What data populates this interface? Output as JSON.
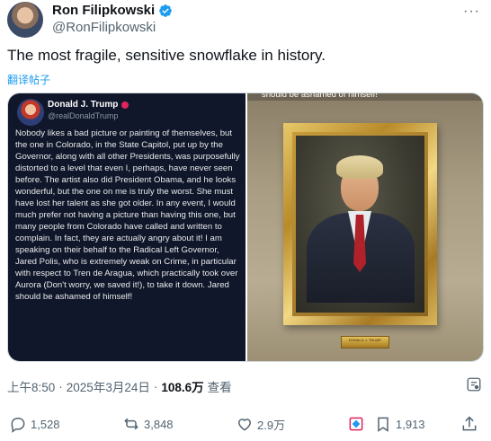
{
  "author": {
    "name": "Ron Filipkowski",
    "handle": "@RonFilipkowski",
    "verified_color": "#1d9bf0"
  },
  "tweet": {
    "text": "The most fragile, sensitive snowflake in history.",
    "translate_label": "翻译帖子"
  },
  "media": {
    "embedded_post": {
      "name": "Donald J. Trump",
      "handle": "@realDonaldTrump",
      "body": "Nobody likes a bad picture or painting of themselves, but the one in Colorado, in the State Capitol, put up by the Governor, along with all other Presidents, was purposefully distorted to a level that even I, perhaps, have never seen before. The artist also did President Obama, and he looks wonderful, but the one on me is truly the worst. She must have lost her talent as she got older. In any event, I would much prefer not having a picture than having this one, but many people from Colorado have called and written to complain. In fact, they are actually angry about it! I am speaking on their behalf to the Radical Left Governor, Jared Polis, who is extremely weak on Crime, in particular with respect to Tren de Aragua, which practically took over Aurora (Don't worry, we saved it!), to take it down. Jared should be ashamed of himself!"
    },
    "photo_caption": "should be ashamed of himself!",
    "plaque_text": "DONALD J. TRUMP"
  },
  "meta": {
    "time": "上午8:50",
    "separator": "·",
    "date": "2025年3月24日",
    "views": "108.6万",
    "views_label": "查看"
  },
  "actions": {
    "replies": "1,528",
    "reposts": "3,848",
    "likes": "2.9万",
    "bookmarks": "1,913"
  },
  "icons": {
    "more": "more-dots-icon",
    "grok": "grok-icon",
    "reply": "reply-icon",
    "repost": "repost-icon",
    "like": "like-icon",
    "bookmark": "bookmark-icon",
    "share": "share-icon",
    "translate_badge": "grok-translate-icon"
  }
}
